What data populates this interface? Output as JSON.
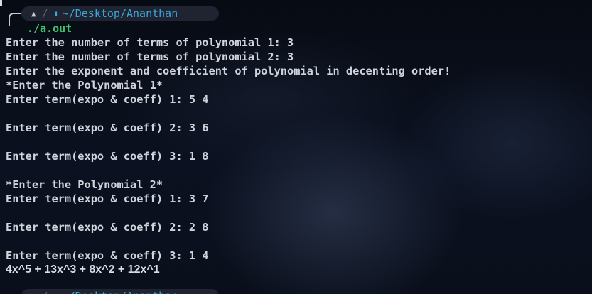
{
  "prompt": {
    "os_icon": "arch-linux-icon",
    "separator": "/",
    "folder_icon": "folder-icon",
    "path": "~/Desktop/Ananthan"
  },
  "command": "./a.out",
  "output_lines": [
    "Enter the number of terms of polynomial 1: 3",
    "Enter the number of terms of polynomial 2: 3",
    "Enter the exponent and coefficient of polynomial in decenting order!",
    "*Enter the Polynomial 1*",
    "Enter term(expo & coeff) 1: 5 4",
    "",
    "Enter term(expo & coeff) 2: 3 6",
    "",
    "Enter term(expo & coeff) 3: 1 8",
    "",
    "*Enter the Polynomial 2*",
    "Enter term(expo & coeff) 1: 3 7",
    "",
    "Enter term(expo & coeff) 2: 2 8",
    "",
    "Enter term(expo & coeff) 3: 1 4",
    "4x^5 + 13x^3 + 8x^2 + 12x^1"
  ],
  "colors": {
    "path": "#39a8dd",
    "command": "#3ec46b",
    "text": "#cfd3dc",
    "pill_bg": "#1f2430"
  }
}
